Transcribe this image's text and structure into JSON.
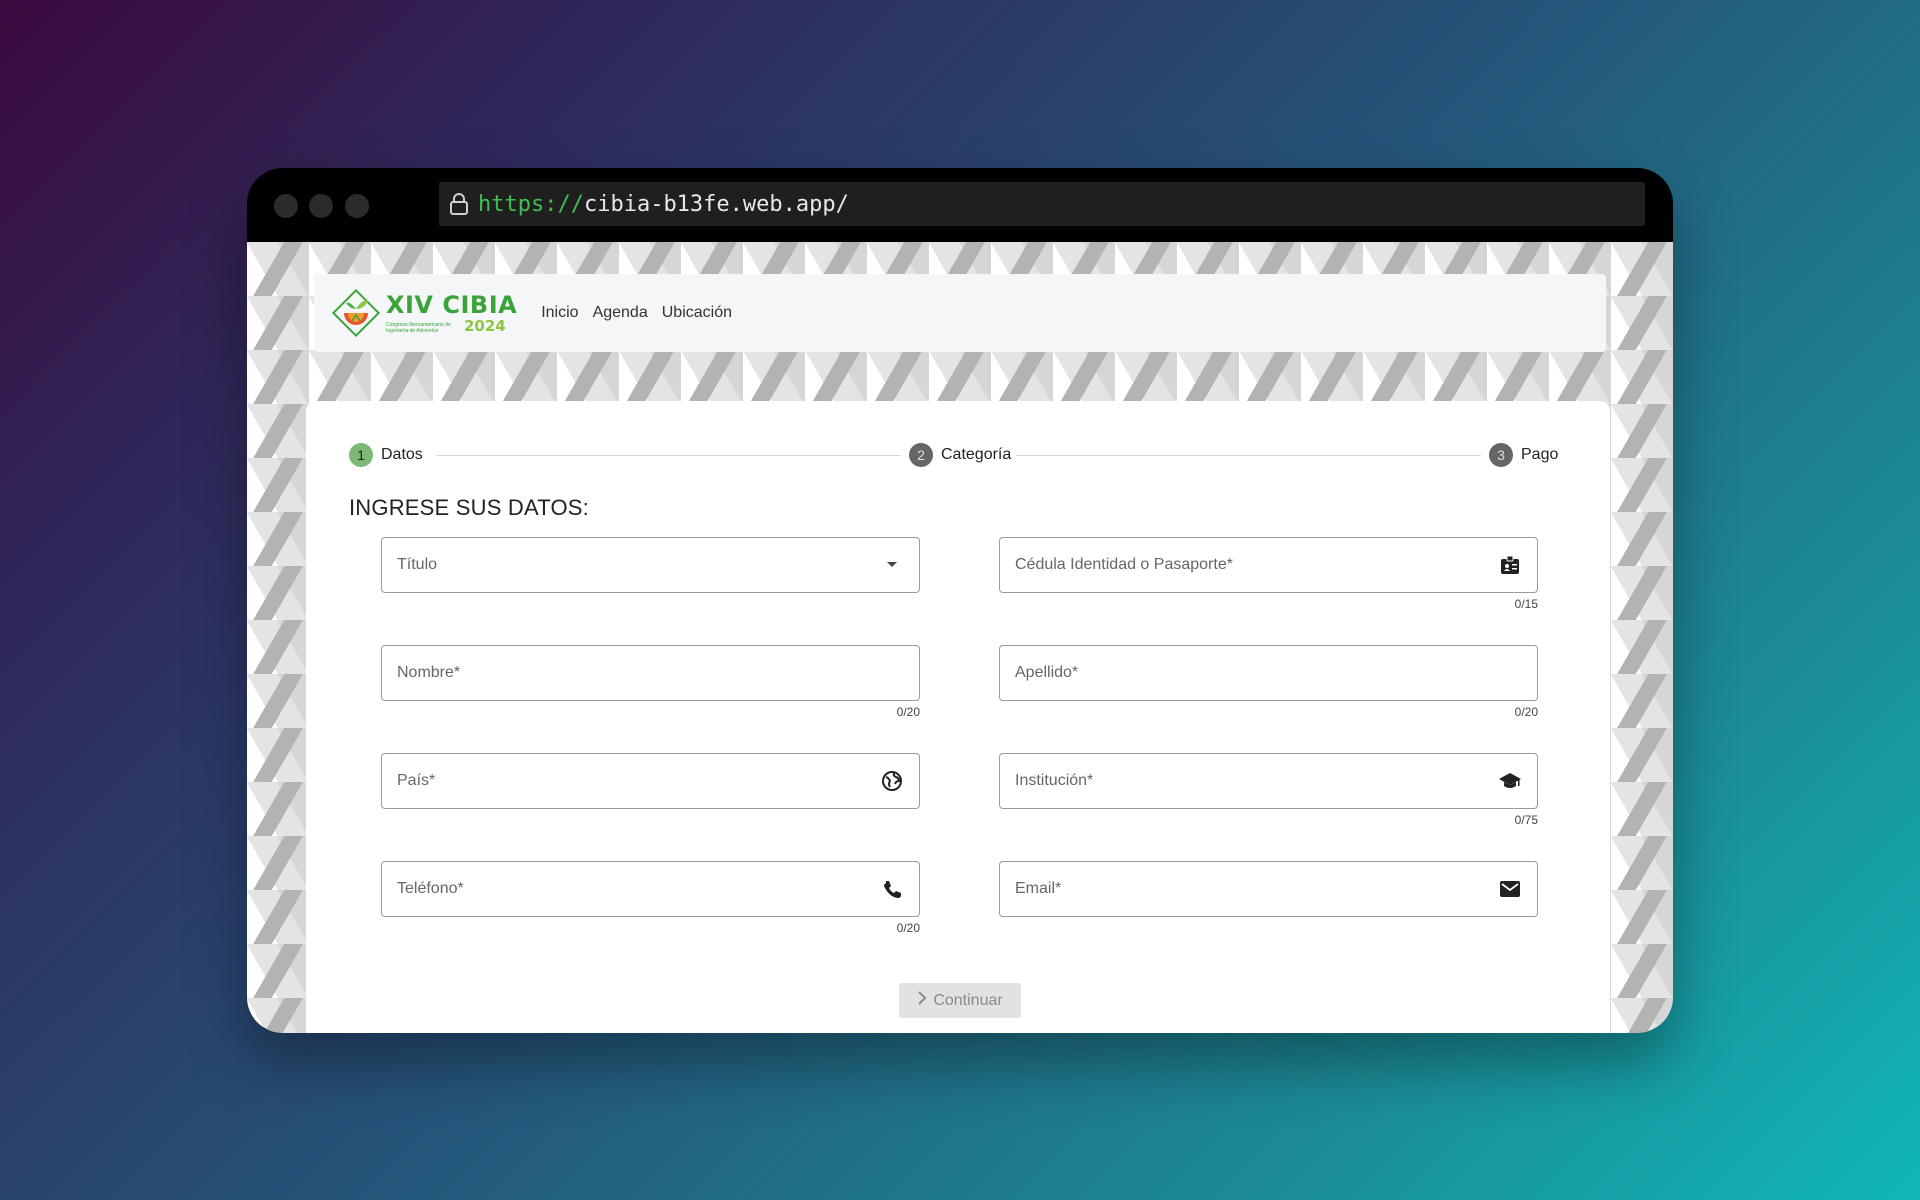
{
  "browser": {
    "url_scheme": "https://",
    "url_rest": "cibia-b13fe.web.app/"
  },
  "navbar": {
    "logo_title": "XIV CIBIA",
    "logo_subtitle": "Congreso Iberoamericano de Ingeniería de Alimentos",
    "logo_year": "2024",
    "links": [
      "Inicio",
      "Agenda",
      "Ubicación"
    ]
  },
  "stepper": {
    "steps": [
      {
        "num": "1",
        "label": "Datos"
      },
      {
        "num": "2",
        "label": "Categoría"
      },
      {
        "num": "3",
        "label": "Pago"
      }
    ]
  },
  "form": {
    "title": "INGRESE SUS DATOS:",
    "fields": {
      "titulo": {
        "placeholder": "Título"
      },
      "cedula": {
        "placeholder": "Cédula Identidad o Pasaporte*",
        "counter": "0/15",
        "icon": "id-card-icon"
      },
      "nombre": {
        "placeholder": "Nombre*",
        "counter": "0/20"
      },
      "apellido": {
        "placeholder": "Apellido*",
        "counter": "0/20"
      },
      "pais": {
        "placeholder": "País*",
        "icon": "globe-icon"
      },
      "institucion": {
        "placeholder": "Institución*",
        "counter": "0/75",
        "icon": "graduation-cap-icon"
      },
      "telefono": {
        "placeholder": "Teléfono*",
        "counter": "0/20",
        "icon": "phone-icon"
      },
      "email": {
        "placeholder": "Email*",
        "icon": "email-icon"
      }
    },
    "continue_label": "Continuar"
  },
  "colors": {
    "step_active": "#7cb974",
    "step_inactive": "#666666",
    "logo_green": "#3aa43a",
    "url_scheme": "#3fbf4f"
  }
}
